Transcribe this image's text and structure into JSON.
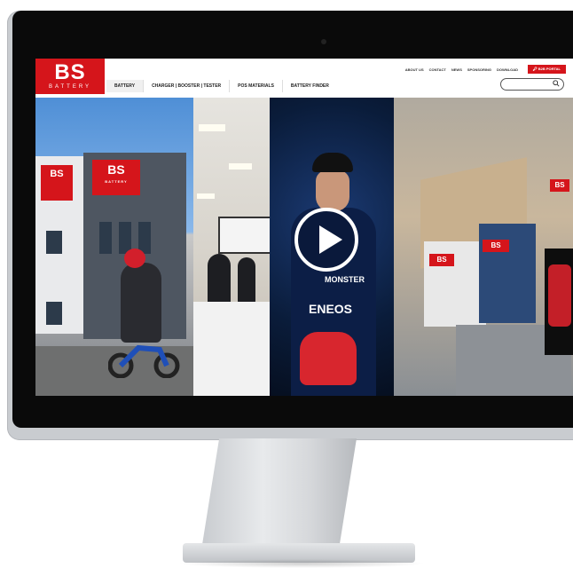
{
  "logo": {
    "main": "BS",
    "sub": "BATTERY"
  },
  "nav": {
    "items": [
      {
        "label": "BATTERY"
      },
      {
        "label": "CHARGER | BOOSTER | TESTER"
      },
      {
        "label": "POS MATERIALS"
      },
      {
        "label": "BATTERY FINDER"
      }
    ]
  },
  "topnav": {
    "items": [
      "ABOUT US",
      "CONTACT",
      "NEWS",
      "SPONSORING",
      "DOWNLOAD"
    ],
    "portal_label": "B2B PORTAL"
  },
  "search": {
    "placeholder": ""
  },
  "hero": {
    "sign_building": "BS",
    "sign_building_sub": "BATTERY",
    "sponsors": [
      "MONSTER",
      "ENEOS"
    ],
    "store_sign": "BS"
  },
  "colors": {
    "brand_red": "#d5151b"
  }
}
